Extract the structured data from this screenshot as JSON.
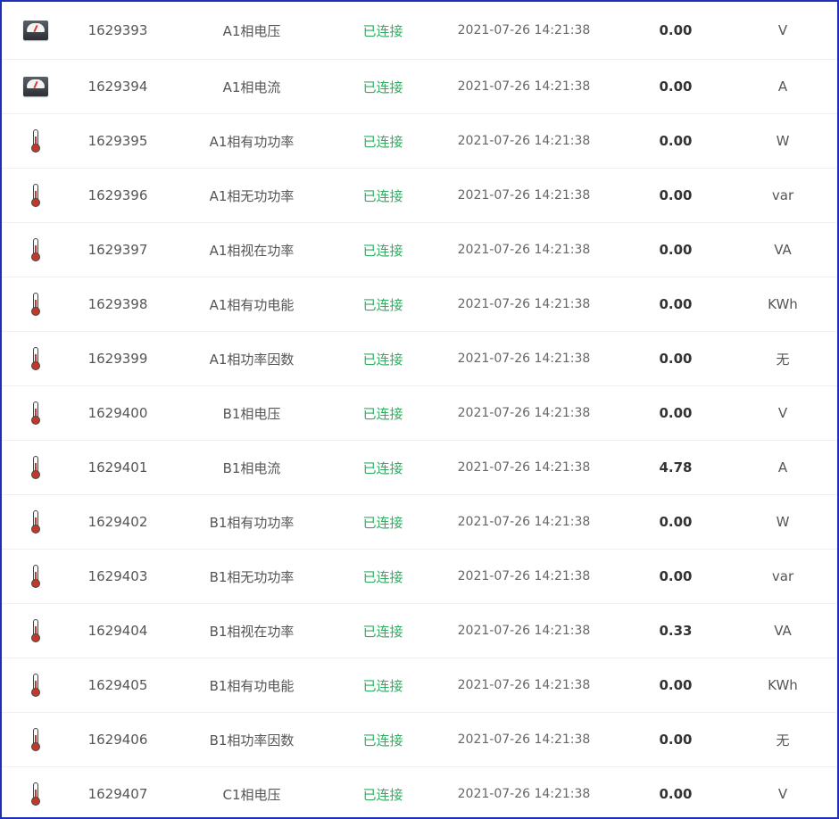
{
  "colors": {
    "frame_border": "#1f2fb8",
    "status_connected": "#2fae62"
  },
  "rows": [
    {
      "icon": "meter-icon",
      "id": "1629393",
      "name": "A1相电压",
      "status": "已连接",
      "time": "2021-07-26 14:21:38",
      "value": "0.00",
      "unit": "V"
    },
    {
      "icon": "meter-icon",
      "id": "1629394",
      "name": "A1相电流",
      "status": "已连接",
      "time": "2021-07-26 14:21:38",
      "value": "0.00",
      "unit": "A"
    },
    {
      "icon": "thermometer-icon",
      "id": "1629395",
      "name": "A1相有功功率",
      "status": "已连接",
      "time": "2021-07-26 14:21:38",
      "value": "0.00",
      "unit": "W"
    },
    {
      "icon": "thermometer-icon",
      "id": "1629396",
      "name": "A1相无功功率",
      "status": "已连接",
      "time": "2021-07-26 14:21:38",
      "value": "0.00",
      "unit": "var"
    },
    {
      "icon": "thermometer-icon",
      "id": "1629397",
      "name": "A1相视在功率",
      "status": "已连接",
      "time": "2021-07-26 14:21:38",
      "value": "0.00",
      "unit": "VA"
    },
    {
      "icon": "thermometer-icon",
      "id": "1629398",
      "name": "A1相有功电能",
      "status": "已连接",
      "time": "2021-07-26 14:21:38",
      "value": "0.00",
      "unit": "KWh"
    },
    {
      "icon": "thermometer-icon",
      "id": "1629399",
      "name": "A1相功率因数",
      "status": "已连接",
      "time": "2021-07-26 14:21:38",
      "value": "0.00",
      "unit": "无"
    },
    {
      "icon": "thermometer-icon",
      "id": "1629400",
      "name": "B1相电压",
      "status": "已连接",
      "time": "2021-07-26 14:21:38",
      "value": "0.00",
      "unit": "V"
    },
    {
      "icon": "thermometer-icon",
      "id": "1629401",
      "name": "B1相电流",
      "status": "已连接",
      "time": "2021-07-26 14:21:38",
      "value": "4.78",
      "unit": "A"
    },
    {
      "icon": "thermometer-icon",
      "id": "1629402",
      "name": "B1相有功功率",
      "status": "已连接",
      "time": "2021-07-26 14:21:38",
      "value": "0.00",
      "unit": "W"
    },
    {
      "icon": "thermometer-icon",
      "id": "1629403",
      "name": "B1相无功功率",
      "status": "已连接",
      "time": "2021-07-26 14:21:38",
      "value": "0.00",
      "unit": "var"
    },
    {
      "icon": "thermometer-icon",
      "id": "1629404",
      "name": "B1相视在功率",
      "status": "已连接",
      "time": "2021-07-26 14:21:38",
      "value": "0.33",
      "unit": "VA"
    },
    {
      "icon": "thermometer-icon",
      "id": "1629405",
      "name": "B1相有功电能",
      "status": "已连接",
      "time": "2021-07-26 14:21:38",
      "value": "0.00",
      "unit": "KWh"
    },
    {
      "icon": "thermometer-icon",
      "id": "1629406",
      "name": "B1相功率因数",
      "status": "已连接",
      "time": "2021-07-26 14:21:38",
      "value": "0.00",
      "unit": "无"
    },
    {
      "icon": "thermometer-icon",
      "id": "1629407",
      "name": "C1相电压",
      "status": "已连接",
      "time": "2021-07-26 14:21:38",
      "value": "0.00",
      "unit": "V"
    }
  ]
}
